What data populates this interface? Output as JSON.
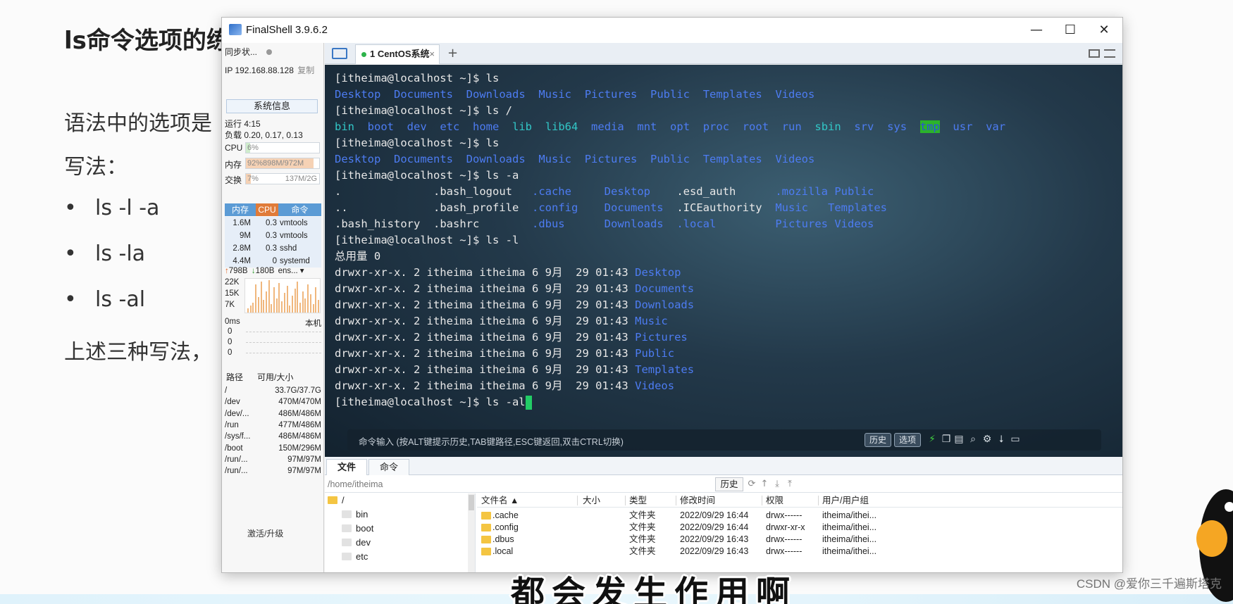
{
  "slide": {
    "title": "ls命令选项的练",
    "line1": "语法中的选项是",
    "line2": "写法：",
    "bullets": [
      "ls -l -a",
      "ls -la",
      "ls -al"
    ],
    "line3": "上述三种写法，",
    "subtitle": "都会发生作用啊",
    "watermark": "CSDN @爱你三千遍斯塔克"
  },
  "window": {
    "title": "FinalShell 3.9.6.2",
    "minimize": "—",
    "maximize": "☐",
    "close": "✕"
  },
  "leftpanel": {
    "sync": "同步状...",
    "ip": "IP 192.168.88.128",
    "copy": "复制",
    "sysinfo": "系统信息",
    "uptime": "运行 4:15",
    "load": "负载 0.20, 0.17, 0.13",
    "cpu_label": "CPU",
    "cpu_value": "6%",
    "cpu_fraction": 0.06,
    "mem_label": "内存",
    "mem_value": "92%898M/972M",
    "mem_fraction": 0.92,
    "swap_label": "交换",
    "swap_value": "7%",
    "swap_size": "137M/2G",
    "swap_fraction": 0.07,
    "proc_headers": [
      "内存",
      "CPU",
      "命令"
    ],
    "processes": [
      {
        "mem": "1.6M",
        "cpu": "0.3",
        "cmd": "vmtools"
      },
      {
        "mem": "9M",
        "cpu": "0.3",
        "cmd": "vmtools"
      },
      {
        "mem": "2.8M",
        "cpu": "0.3",
        "cmd": "sshd"
      },
      {
        "mem": "4.4M",
        "cpu": "0",
        "cmd": "systemd"
      }
    ],
    "net_up": "798B",
    "net_down": "180B",
    "net_iface": "ens...",
    "net_scale": [
      "22K",
      "15K",
      "7K"
    ],
    "ping_label": "0ms",
    "ping_host": "本机",
    "ping_values": [
      "0",
      "0",
      "0"
    ],
    "disk_headers": [
      "路径",
      "可用/大小"
    ],
    "disks": [
      {
        "path": "/",
        "size": "33.7G/37.7G"
      },
      {
        "path": "/dev",
        "size": "470M/470M"
      },
      {
        "path": "/dev/...",
        "size": "486M/486M"
      },
      {
        "path": "/run",
        "size": "477M/486M"
      },
      {
        "path": "/sys/f...",
        "size": "486M/486M"
      },
      {
        "path": "/boot",
        "size": "150M/296M"
      },
      {
        "path": "/run/...",
        "size": "97M/97M"
      },
      {
        "path": "/run/...",
        "size": "97M/97M"
      }
    ],
    "upgrade": "激活/升级"
  },
  "tabs": {
    "session": "1 CentOS系统",
    "close": "×",
    "add": "+"
  },
  "terminal": {
    "prompt": "[itheima@localhost ~]$ ",
    "cmd1": "ls",
    "ls_home": [
      "Desktop",
      "Documents",
      "Downloads",
      "Music",
      "Pictures",
      "Public",
      "Templates",
      "Videos"
    ],
    "cmd2": "ls /",
    "ls_root": [
      "bin",
      "boot",
      "dev",
      "etc",
      "home",
      "lib",
      "lib64",
      "media",
      "mnt",
      "opt",
      "proc",
      "root",
      "run",
      "sbin",
      "srv",
      "sys",
      "tmp",
      "usr",
      "var"
    ],
    "cmd3": "ls",
    "cmd4": "ls -a",
    "la_row1": [
      ".",
      ".bash_logout",
      ".cache",
      "Desktop",
      ".esd_auth",
      ".mozilla",
      "Public"
    ],
    "la_row2": [
      "..",
      ".bash_profile",
      ".config",
      "Documents",
      ".ICEauthority",
      "Music",
      "Templates"
    ],
    "la_row3": [
      ".bash_history",
      ".bashrc",
      ".dbus",
      "Downloads",
      ".local",
      "Pictures",
      "Videos"
    ],
    "cmd5": "ls -l",
    "total": "总用量 0",
    "ll_prefix": "drwxr-xr-x. 2 itheima itheima 6 9月  29 01:43 ",
    "cmd6": "ls -al",
    "cmdbar_hint": "命令输入 (按ALT键提示历史,TAB键路径,ESC键返回,双击CTRL切换)",
    "history_btn": "历史",
    "options_btn": "选项"
  },
  "files": {
    "tab_files": "文件",
    "tab_commands": "命令",
    "path": "/home/itheima",
    "history": "历史",
    "tree": [
      {
        "name": "/",
        "level": 0
      },
      {
        "name": "bin",
        "level": 1
      },
      {
        "name": "boot",
        "level": 1
      },
      {
        "name": "dev",
        "level": 1
      },
      {
        "name": "etc",
        "level": 1
      }
    ],
    "headers": {
      "name": "文件名 ▲",
      "size": "大小",
      "type": "类型",
      "mtime": "修改时间",
      "perm": "权限",
      "owner": "用户/用户组"
    },
    "rows": [
      {
        "name": ".cache",
        "type": "文件夹",
        "mtime": "2022/09/29 16:44",
        "perm": "drwx------",
        "owner": "itheima/ithei..."
      },
      {
        "name": ".config",
        "type": "文件夹",
        "mtime": "2022/09/29 16:44",
        "perm": "drwxr-xr-x",
        "owner": "itheima/ithei..."
      },
      {
        "name": ".dbus",
        "type": "文件夹",
        "mtime": "2022/09/29 16:43",
        "perm": "drwx------",
        "owner": "itheima/ithei..."
      },
      {
        "name": ".local",
        "type": "文件夹",
        "mtime": "2022/09/29 16:43",
        "perm": "drwx------",
        "owner": "itheima/ithei..."
      }
    ]
  },
  "colors": {
    "dir_blue": "#4d7cf2",
    "link_cyan": "#32c7c7",
    "tmp_bg": "#2bb32b",
    "cursor": "#22cc66"
  }
}
